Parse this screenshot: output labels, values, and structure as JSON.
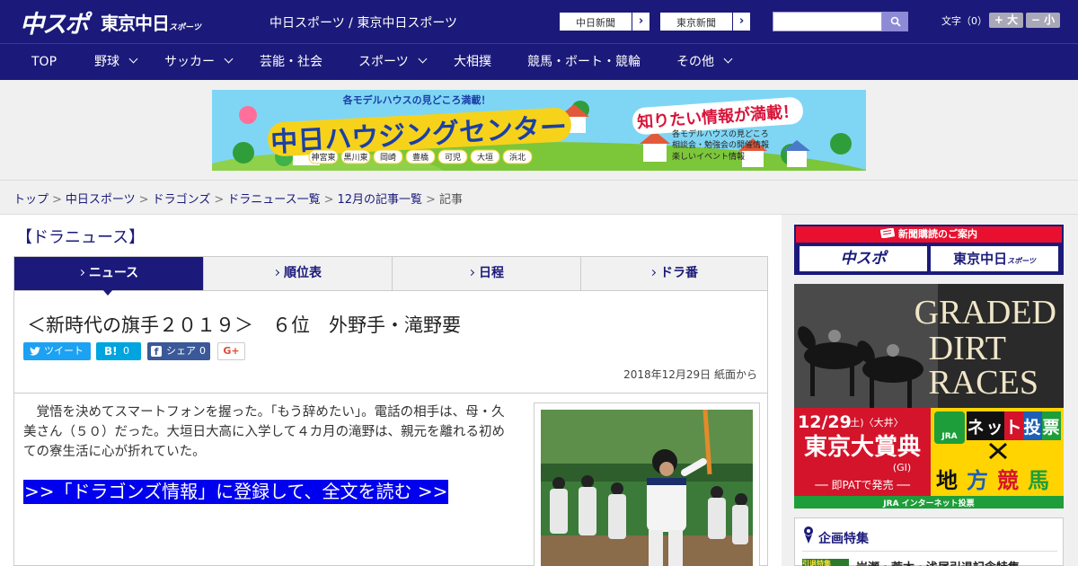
{
  "header": {
    "logo_chunichi_sports": "中スポ",
    "logo_tokyo_chunichi": "東京中日",
    "logo_tokyo_chunichi_small": "スポーツ",
    "site_title": "中日スポーツ / 東京中日スポーツ",
    "link_chunichi_shimbun": "中日新聞",
    "link_tokyo_shimbun": "東京新聞",
    "link_arrow": "›",
    "search_placeholder": "",
    "font_size_label": "文字（0）",
    "font_plus": "+ 大",
    "font_minus": "− 小"
  },
  "nav": {
    "items": [
      {
        "label": "TOP",
        "dropdown": false
      },
      {
        "label": "野球",
        "dropdown": true
      },
      {
        "label": "サッカー",
        "dropdown": true
      },
      {
        "label": "芸能・社会",
        "dropdown": false
      },
      {
        "label": "スポーツ",
        "dropdown": true
      },
      {
        "label": "大相撲",
        "dropdown": false
      },
      {
        "label": "競馬・ボート・競輪",
        "dropdown": false
      },
      {
        "label": "その他",
        "dropdown": true
      }
    ]
  },
  "banner": {
    "top_text": "各モデルハウスの見どころ満載！",
    "title": "中日ハウジングセンター",
    "tagline": "知りたい情報が満載！",
    "bullets": [
      "各モデルハウスの見どころ",
      "相談会・勉強会の開催情報",
      "楽しいイベント情報"
    ],
    "locations": [
      "神宮東",
      "黒川東",
      "岡崎",
      "豊橋",
      "可児",
      "大垣",
      "浜北"
    ],
    "colors": {
      "sky": "#7fd6f4",
      "title_bg": "#f6d21a",
      "title_fg": "#1b3fa8",
      "tagline_fg": "#d8143a",
      "grass": "#7cc63a"
    }
  },
  "breadcrumb": {
    "items": [
      "トップ",
      "中日スポーツ",
      "ドラゴンズ",
      "ドラニュース一覧",
      "12月の記事一覧"
    ],
    "current": "記事",
    "separator": ">"
  },
  "section": {
    "title": "【ドラニュース】"
  },
  "tabs": [
    {
      "label": "ニュース",
      "active": true
    },
    {
      "label": "順位表",
      "active": false
    },
    {
      "label": "日程",
      "active": false
    },
    {
      "label": "ドラ番",
      "active": false
    }
  ],
  "article": {
    "headline": "＜新時代の旗手２０１９＞　６位　外野手・滝野要",
    "share": {
      "tweet_label": "ツイート",
      "hatena_label": "B!",
      "hatena_count": "0",
      "facebook_label": "シェア",
      "facebook_count": "0",
      "gplus_label": "G+"
    },
    "date": "2018年12月29日 紙面から",
    "body": "　覚悟を決めてスマートフォンを握った。「もう辞めたい」。電話の相手は、母・久美さん（５０）だった。大垣日大高に入学して４カ月の滝野は、親元を離れる初めての寮生活に心が折れていた。",
    "cta": ">>「ドラゴンズ情報」に登録して、全文を読む >>"
  },
  "sidebar": {
    "subscribe_ad": {
      "header": "新聞購読のご案内",
      "buttons": [
        "中スポ",
        "東京中日"
      ],
      "button_small": "スポーツ"
    },
    "jra_ad": {
      "headline_lines": [
        "GRADED",
        "DIRT",
        "RACES"
      ],
      "date": "12/29",
      "date_detail": "(土)〈大井〉",
      "race_name": "東京大賞典",
      "grade": "(GI)",
      "sale_text": "── 即PATで発売 ──",
      "jra_label": "JRA",
      "net_vote": [
        "ネ",
        "ッ",
        "ト",
        "投",
        "票"
      ],
      "local_racing": [
        "地",
        "方",
        "競",
        "馬"
      ],
      "footer": "JRA インターネット投票",
      "colors": {
        "red": "#d4142b",
        "yellow": "#ffd400",
        "green": "#1e9e3a",
        "blue": "#1d5fb8"
      }
    },
    "feature": {
      "title": "企画特集",
      "thumb_label": "引退特集",
      "item": "岩瀬・荒木・浅尾引退記念特集"
    }
  },
  "colors": {
    "brand_navy": "#1b1a7a",
    "cta_blue": "#0000ee",
    "twitter": "#1da1f2",
    "hatena": "#00a4de",
    "facebook": "#3b5998",
    "gplus_red": "#dd4b39"
  }
}
